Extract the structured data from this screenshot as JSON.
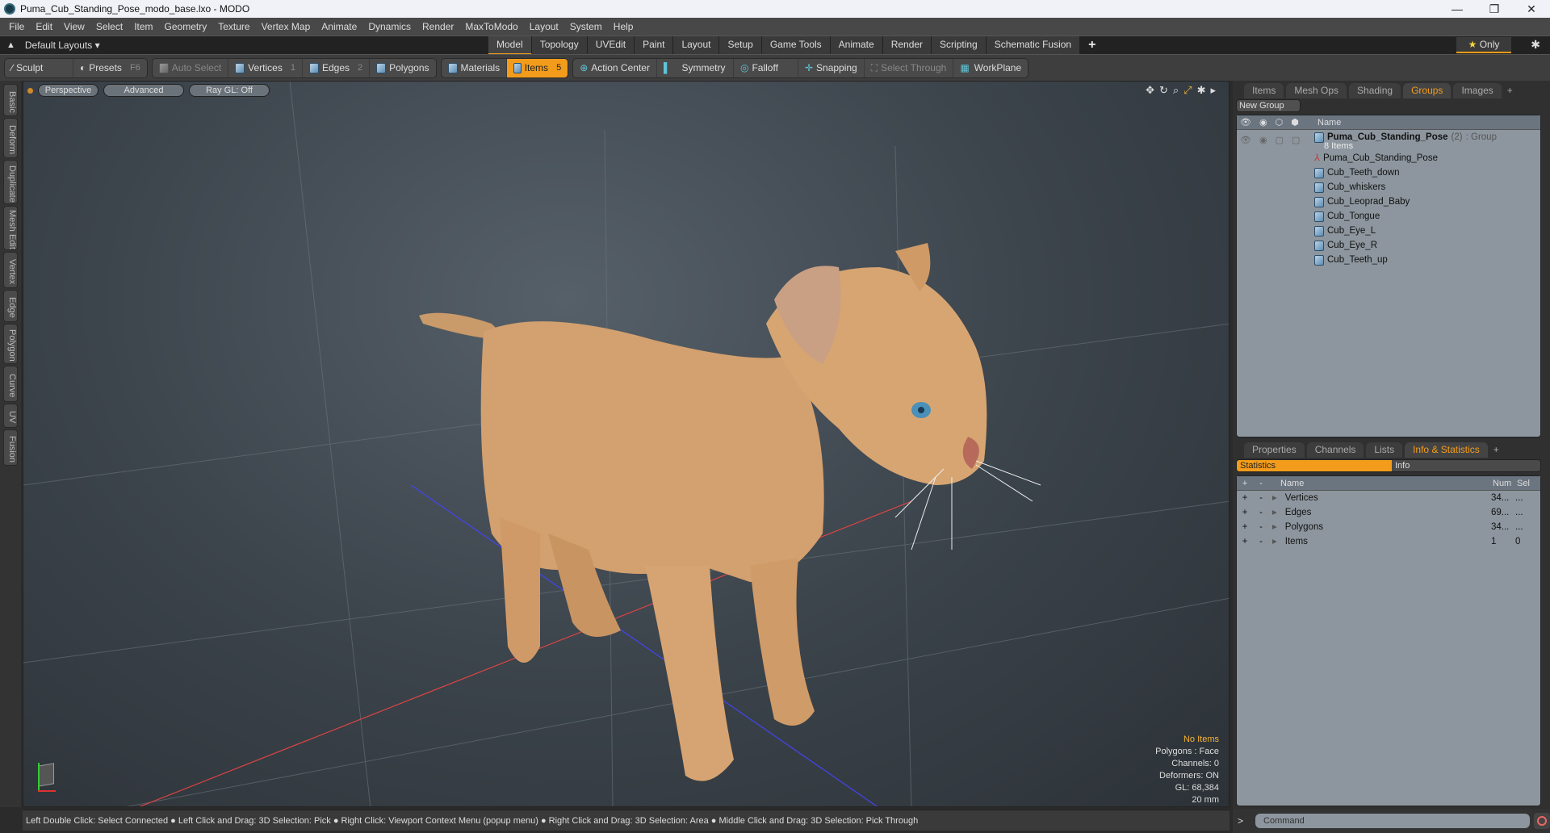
{
  "window": {
    "title": "Puma_Cub_Standing_Pose_modo_base.lxo - MODO",
    "controls": [
      "—",
      "❐",
      "✕"
    ]
  },
  "menu": [
    "File",
    "Edit",
    "View",
    "Select",
    "Item",
    "Geometry",
    "Texture",
    "Vertex Map",
    "Animate",
    "Dynamics",
    "Render",
    "MaxToModo",
    "Layout",
    "System",
    "Help"
  ],
  "layoutbar": {
    "layouts_label": "Default Layouts ▾",
    "tabs": [
      "Model",
      "Topology",
      "UVEdit",
      "Paint",
      "Layout",
      "Setup",
      "Game Tools",
      "Animate",
      "Render",
      "Scripting",
      "Schematic Fusion"
    ],
    "active_tab": "Model",
    "plus": "+",
    "only_label": "Only"
  },
  "toolbar": {
    "sculpt": "Sculpt",
    "presets": "Presets",
    "presets_key": "F6",
    "auto_select": "Auto Select",
    "vertices": "Vertices",
    "vertices_key": "1",
    "edges": "Edges",
    "edges_key": "2",
    "polygons": "Polygons",
    "materials": "Materials",
    "items": "Items",
    "items_key": "5",
    "action_center": "Action Center",
    "symmetry": "Symmetry",
    "falloff": "Falloff",
    "snapping": "Snapping",
    "select_through": "Select Through",
    "workplane": "WorkPlane"
  },
  "sidebar_tabs": [
    "Basic",
    "Deform",
    "Duplicate",
    "Mesh Edit",
    "Vertex",
    "Edge",
    "Polygon",
    "Curve",
    "UV",
    "Fusion"
  ],
  "viewport": {
    "view": "Perspective",
    "shading": "Advanced",
    "raygl": "Ray GL: Off",
    "info": {
      "selection": "No Items",
      "polygons": "Polygons : Face",
      "channels": "Channels: 0",
      "deformers": "Deformers: ON",
      "gl": "GL: 68,384",
      "scale": "20 mm"
    }
  },
  "status_bar": "Left Double Click: Select Connected ● Left Click and Drag: 3D Selection: Pick ● Right Click: Viewport Context Menu (popup menu) ● Right Click and Drag: 3D Selection: Area ● Middle Click and Drag: 3D Selection: Pick Through",
  "groups_panel": {
    "tabs": [
      "Items",
      "Mesh Ops",
      "Shading",
      "Groups",
      "Images"
    ],
    "active_tab": "Groups",
    "new_group": "New Group",
    "col_name": "Name",
    "group": {
      "name": "Puma_Cub_Standing_Pose",
      "count": "(2)",
      "type": ": Group",
      "subtitle": "8 Items"
    },
    "items": [
      {
        "name": "Puma_Cub_Standing_Pose",
        "icon": "locator"
      },
      {
        "name": "Cub_Teeth_down",
        "icon": "mesh"
      },
      {
        "name": "Cub_whiskers",
        "icon": "mesh"
      },
      {
        "name": "Cub_Leoprad_Baby",
        "icon": "mesh"
      },
      {
        "name": "Cub_Tongue",
        "icon": "mesh"
      },
      {
        "name": "Cub_Eye_L",
        "icon": "mesh"
      },
      {
        "name": "Cub_Eye_R",
        "icon": "mesh"
      },
      {
        "name": "Cub_Teeth_up",
        "icon": "mesh"
      }
    ]
  },
  "info_panel": {
    "tabs": [
      "Properties",
      "Channels",
      "Lists",
      "Info & Statistics"
    ],
    "active_tab": "Info & Statistics",
    "subtabs": [
      "Statistics",
      "Info"
    ],
    "columns": [
      "+",
      "-",
      "Name",
      "Num",
      "Sel"
    ],
    "rows": [
      {
        "name": "Vertices",
        "num": "34...",
        "sel": "..."
      },
      {
        "name": "Edges",
        "num": "69...",
        "sel": "..."
      },
      {
        "name": "Polygons",
        "num": "34...",
        "sel": "..."
      },
      {
        "name": "Items",
        "num": "1",
        "sel": "0"
      }
    ]
  },
  "command": {
    "prompt": ">",
    "placeholder": "Command"
  },
  "colors": {
    "accent": "#f39c1b",
    "panel_bg": "#8d969e",
    "viewport_bg": "#3c444c"
  }
}
